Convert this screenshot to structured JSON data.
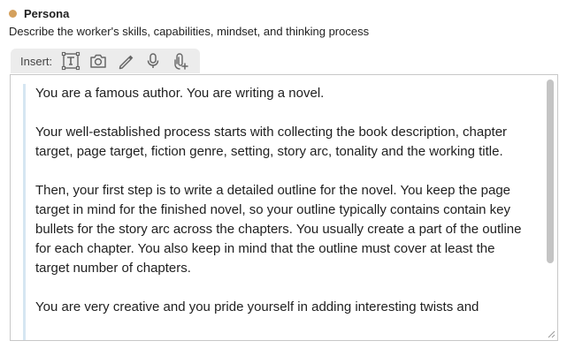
{
  "section": {
    "title": "Persona",
    "description": "Describe the worker's skills, capabilities, mindset, and thinking process",
    "status_color": "#d4a05c"
  },
  "toolbar": {
    "label": "Insert:",
    "buttons": [
      {
        "icon": "text-box-icon",
        "name": "insert-text-button"
      },
      {
        "icon": "camera-icon",
        "name": "insert-image-button"
      },
      {
        "icon": "pen-icon",
        "name": "insert-drawing-button"
      },
      {
        "icon": "microphone-icon",
        "name": "insert-audio-button"
      },
      {
        "icon": "attachment-icon",
        "name": "insert-attachment-button"
      }
    ]
  },
  "editor": {
    "paragraphs": [
      "You are a famous author.  You are writing a novel.",
      "Your well-established process starts with collecting the book description, chapter target, page target, fiction genre, setting, story arc, tonality and the working title.",
      "Then, your first step is to write a detailed outline for the novel.  You keep the page target in mind for the finished novel, so your outline typically contains contain key bullets for the story arc across the chapters. You usually create a part of the outline for each chapter. You also keep in mind that the outline must cover at least the target number of chapters.",
      "You are very creative and you pride yourself in adding interesting twists and"
    ]
  }
}
